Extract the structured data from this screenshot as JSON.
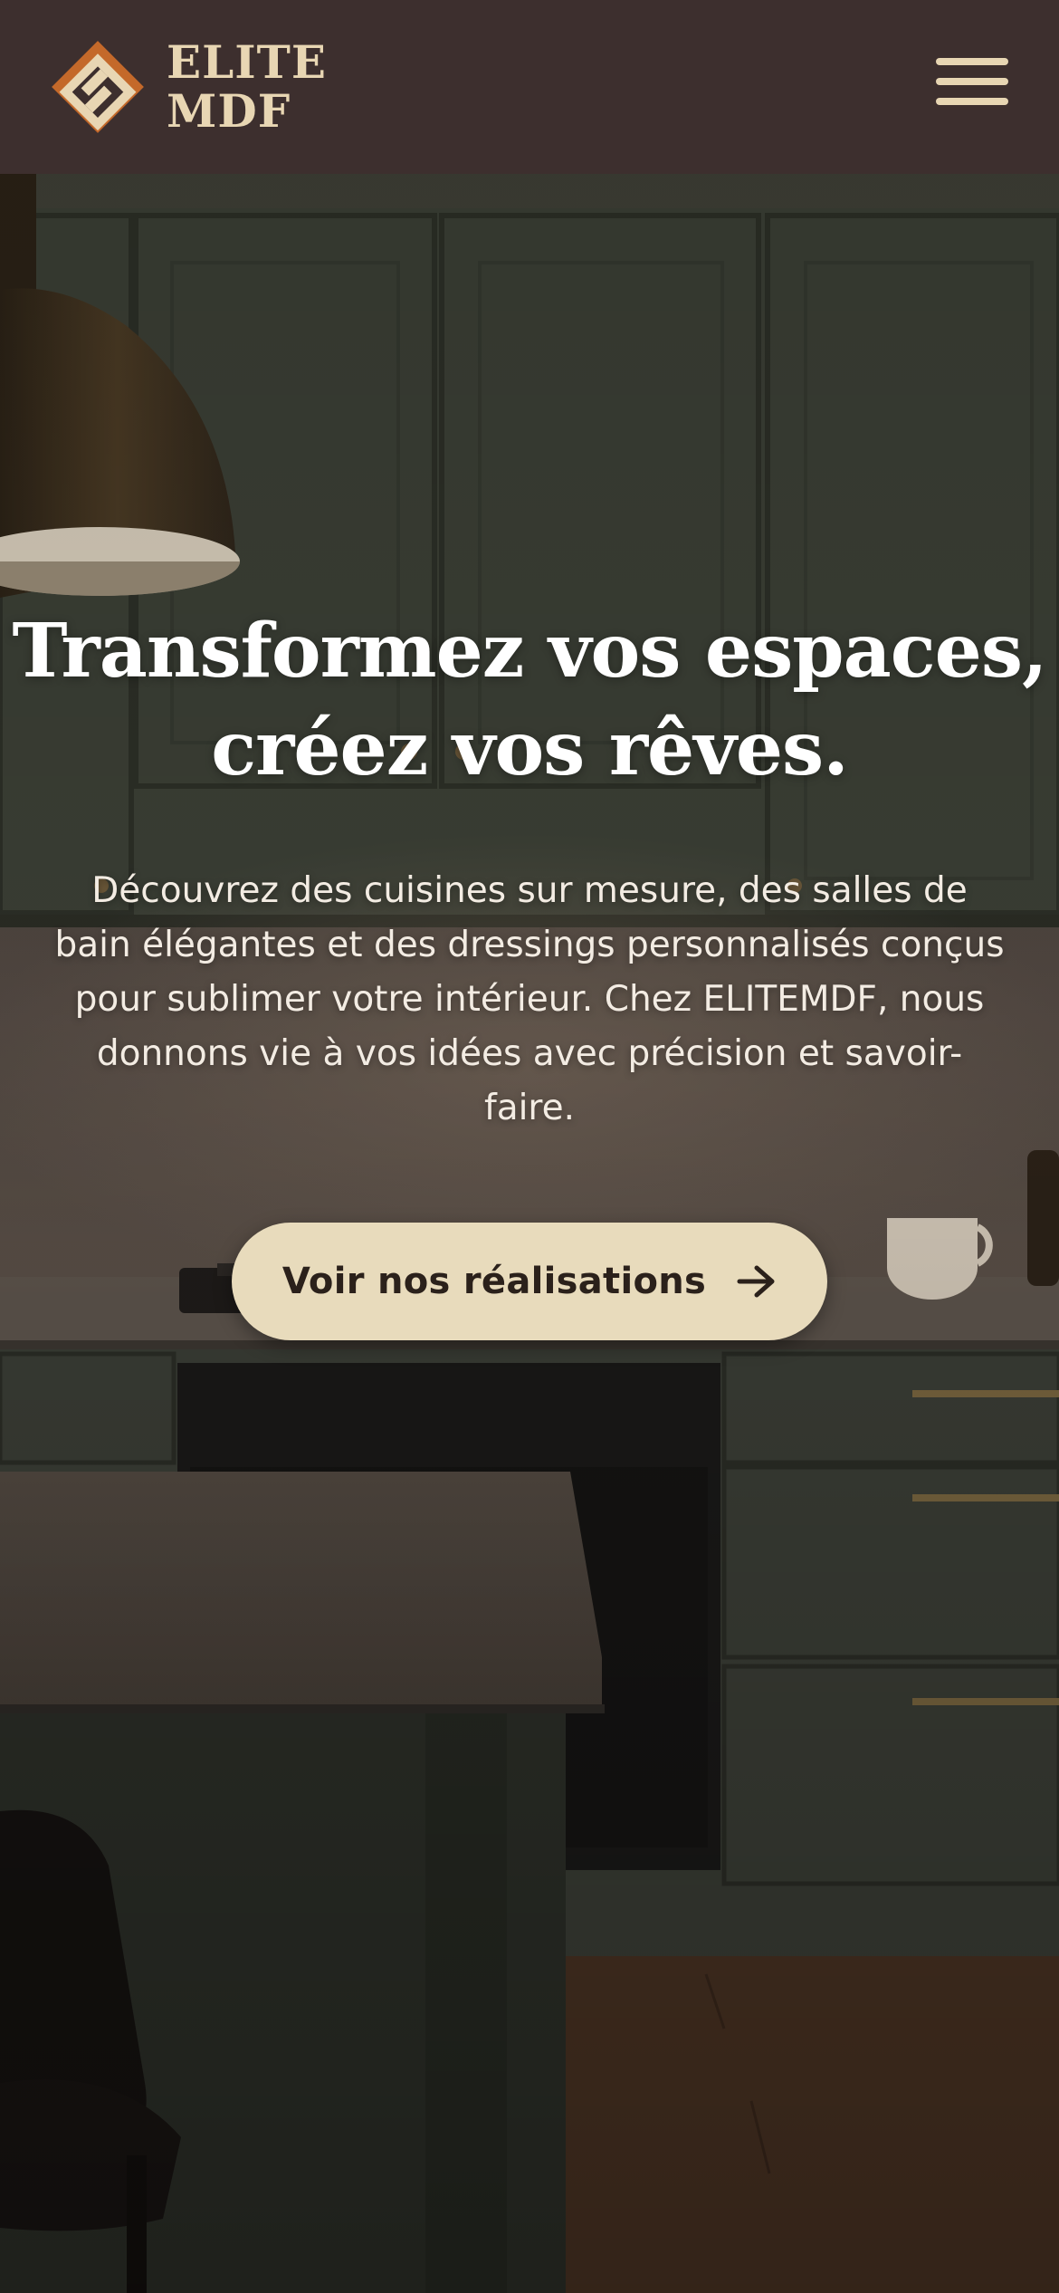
{
  "header": {
    "logo_line1": "ELITE",
    "logo_line2": "MDF",
    "menu_icon": "hamburger-menu-icon"
  },
  "hero": {
    "title_line1": "Transformez vos espaces,",
    "title_line2": "créez vos rêves.",
    "description": "Découvrez des cuisines sur mesure, des salles de bain élégantes et des dressings personnalisés conçus pour sublimer votre intérieur. Chez ELITEMDF, nous donnons vie à vos idées avec précision et savoir-faire.",
    "cta_label": "Voir nos réalisations",
    "cta_icon": "arrow-right-icon",
    "background_image": "kitchen-photo"
  },
  "colors": {
    "header_bg": "#3d2f2e",
    "brand_beige": "#e8d6b3",
    "logo_orange": "#c4692a",
    "cta_bg": "#e8dbbc",
    "cta_text": "#2b211b"
  }
}
